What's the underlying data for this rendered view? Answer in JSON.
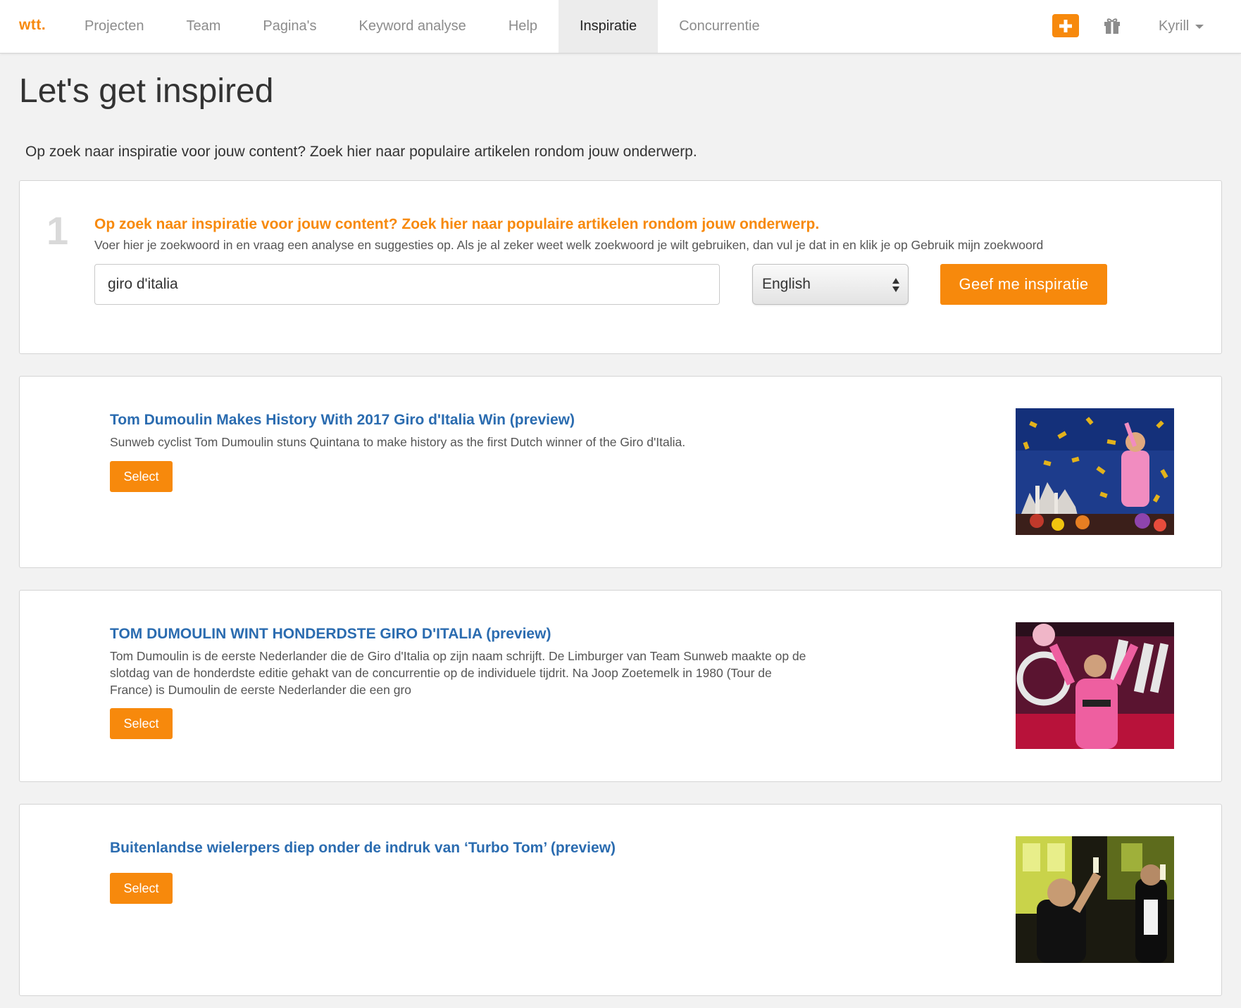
{
  "nav": {
    "logo": "wtt.",
    "tabs": [
      {
        "label": "Projecten"
      },
      {
        "label": "Team"
      },
      {
        "label": "Pagina's"
      },
      {
        "label": "Keyword analyse"
      },
      {
        "label": "Help"
      },
      {
        "label": "Inspiratie",
        "active": true
      },
      {
        "label": "Concurrentie"
      }
    ],
    "icons": {
      "add": "plus-icon",
      "gift": "gift-icon",
      "dropdown": "caret-down-icon"
    },
    "user": "Kyrill"
  },
  "page": {
    "title": "Let's get inspired",
    "intro": "Op zoek naar inspiratie voor jouw content? Zoek hier naar populaire artikelen rondom jouw onderwerp."
  },
  "search": {
    "step_number": "1",
    "step_title": "Op zoek naar inspiratie voor jouw content? Zoek hier naar populaire artikelen rondom jouw onderwerp.",
    "step_description": "Voer hier je zoekwoord in en vraag een analyse en suggesties op. Als je al zeker weet welk zoekwoord je wilt gebruiken, dan vul je dat in en klik je op Gebruik mijn zoekwoord",
    "query": "giro d'italia",
    "language": "English",
    "submit_label": "Geef me inspiratie"
  },
  "results": [
    {
      "title": "Tom Dumoulin Makes History With 2017 Giro d'Italia Win (preview)",
      "description": "Sunweb cyclist Tom Dumoulin stuns Quintana to make history as the first Dutch winner of the Giro d'Italia.",
      "select_label": "Select"
    },
    {
      "title": "TOM DUMOULIN WINT HONDERDSTE GIRO D'ITALIA (preview)",
      "description": "Tom Dumoulin is de eerste Nederlander die de Giro d'Italia op zijn naam schrijft. De Limburger van Team Sunweb maakte op de slotdag van de honderdste editie gehakt van de concurrentie op de individuele tijdrit. Na Joop Zoetemelk in 1980 (Tour de France) is Dumoulin de eerste Nederlander die een gro",
      "select_label": "Select"
    },
    {
      "title": "Buitenlandse wielerpers diep onder de indruk van ‘Turbo Tom’ (preview)",
      "description": "",
      "select_label": "Select"
    }
  ],
  "colors": {
    "accent": "#f7890c",
    "link": "#2b6cb0",
    "background": "#f2f2f2",
    "panel": "#ffffff"
  }
}
